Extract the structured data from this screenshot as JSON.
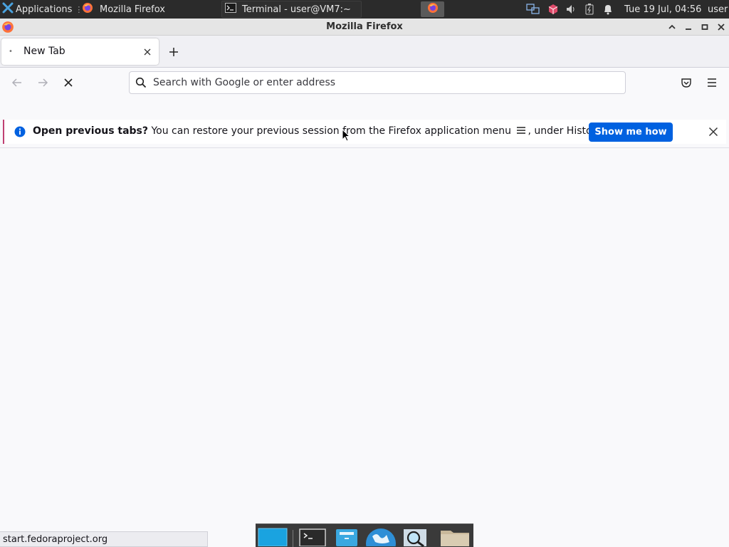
{
  "panel": {
    "applications_label": "Applications",
    "applications_more": "⋮",
    "tasks": [
      {
        "label": "Mozilla Firefox",
        "icon": "firefox-icon"
      },
      {
        "label": "Terminal - user@VM7:~",
        "icon": "terminal-icon"
      }
    ],
    "clock": "Tue 19 Jul, 04:56",
    "user": "user",
    "tray_icons": [
      "network-icon",
      "package-icon",
      "volume-icon",
      "power-icon",
      "notification-bell-icon"
    ]
  },
  "window": {
    "title": "Mozilla Firefox"
  },
  "tabs": [
    {
      "label": "New Tab",
      "active": true
    }
  ],
  "urlbar": {
    "placeholder": "Search with Google or enter address",
    "value": ""
  },
  "notification": {
    "title": "Open previous tabs?",
    "message_before": " You can restore your previous session from the Firefox application menu ",
    "message_after": ", under History.",
    "button_label": "Show me how"
  },
  "status": {
    "text": "start.fedoraproject.org"
  },
  "dock": {
    "items": [
      "show-desktop-icon",
      "terminal-icon",
      "file-manager-icon",
      "web-browser-icon",
      "search-icon",
      "folder-icon"
    ]
  },
  "colors": {
    "accent": "#0061e0",
    "panel_bg": "#2b2b2b",
    "notification_stripe": "#c04072",
    "toolbar_bg": "#f9f9fb",
    "tabstrip_bg": "#f0f0f4"
  }
}
